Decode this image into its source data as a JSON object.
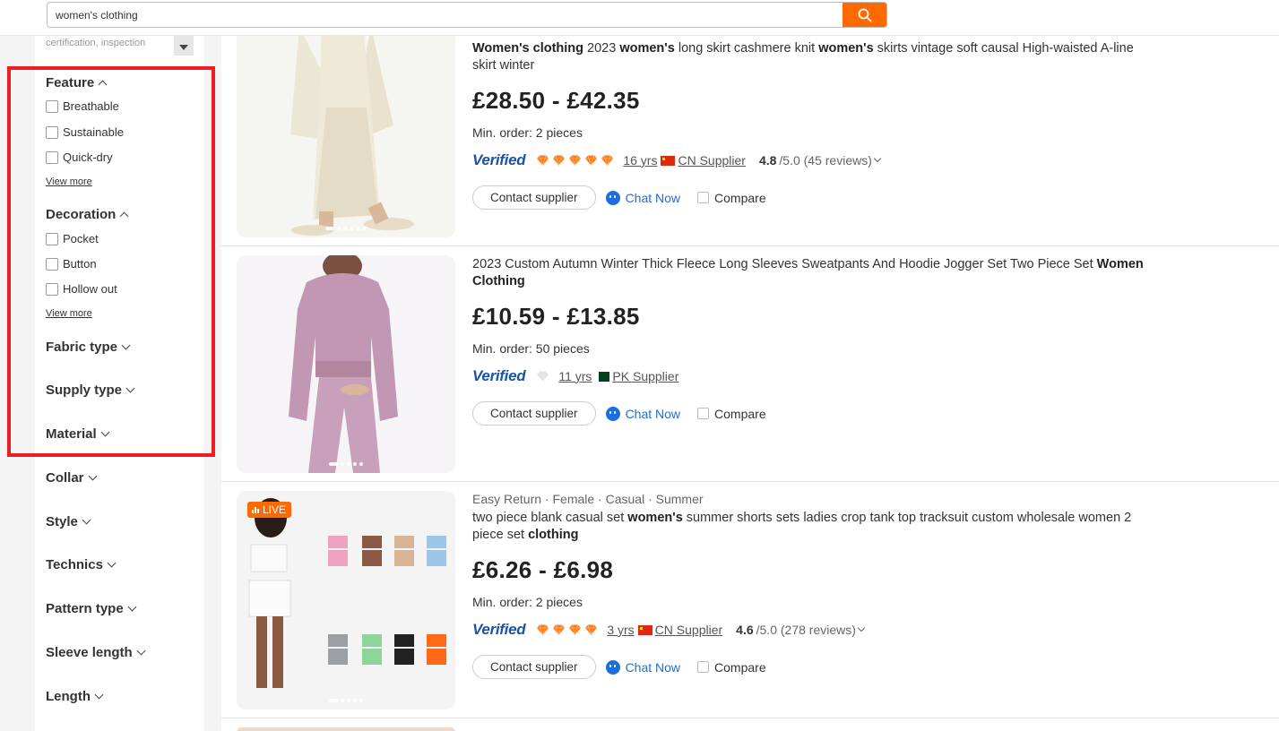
{
  "search": {
    "value": "women's clothing",
    "icon": "search-icon"
  },
  "sidebar": {
    "cert_label": "certification, inspection",
    "feature": {
      "title": "Feature",
      "options": [
        "Breathable",
        "Sustainable",
        "Quick-dry"
      ],
      "view_more": "View more"
    },
    "decoration": {
      "title": "Decoration",
      "options": [
        "Pocket",
        "Button",
        "Hollow out"
      ],
      "view_more": "View more"
    },
    "collapsed": [
      "Fabric type",
      "Supply type",
      "Material",
      "Collar",
      "Style",
      "Technics",
      "Pattern type",
      "Sleeve length",
      "Length"
    ]
  },
  "products": [
    {
      "title_parts": [
        [
          "b",
          "Women's clothing"
        ],
        [
          "t",
          " 2023 "
        ],
        [
          "b",
          "women's"
        ],
        [
          "t",
          " long skirt cashmere knit "
        ],
        [
          "b",
          "women's"
        ],
        [
          "t",
          " skirts vintage soft causal High-waisted A-line skirt winter"
        ]
      ],
      "price": "£28.50 - £42.35",
      "moq": "Min. order: 2 pieces",
      "verified": "Verified",
      "diamonds": 5,
      "years": "16 yrs",
      "country": "CN",
      "supplier": "CN Supplier",
      "rating": "4.8",
      "rating_rest": "/5.0 (45 reviews)",
      "contact": "Contact supplier",
      "chat": "Chat Now",
      "compare": "Compare"
    },
    {
      "title_parts": [
        [
          "t",
          "2023 Custom Autumn Winter Thick Fleece Long Sleeves Sweatpants And Hoodie Jogger Set Two Piece Set "
        ],
        [
          "b",
          "Women Clothing"
        ]
      ],
      "price": "£10.59 - £13.85",
      "moq": "Min. order: 50 pieces",
      "verified": "Verified",
      "diamonds": 0,
      "years": "11 yrs",
      "country": "PK",
      "supplier": "PK Supplier",
      "contact": "Contact supplier",
      "chat": "Chat Now",
      "compare": "Compare"
    },
    {
      "live": "LIVE",
      "tags": "Easy Return · Female · Casual · Summer",
      "title_parts": [
        [
          "t",
          "two piece blank casual set "
        ],
        [
          "b",
          "women's"
        ],
        [
          "t",
          " summer shorts sets ladies crop tank top tracksuit custom wholesale women 2 piece set "
        ],
        [
          "b",
          "clothing"
        ]
      ],
      "price": "£6.26 - £6.98",
      "moq": "Min. order: 2 pieces",
      "verified": "Verified",
      "diamonds": 4,
      "years": "3 yrs",
      "country": "CN",
      "supplier": "CN Supplier",
      "rating": "4.6",
      "rating_rest": "/5.0 (278 reviews)",
      "contact": "Contact supplier",
      "chat": "Chat Now",
      "compare": "Compare"
    }
  ],
  "colors": {
    "accent": "#ff6a00",
    "highlight": "#ee1c25",
    "verified": "#1a54a8",
    "link": "#1a6fdc"
  }
}
